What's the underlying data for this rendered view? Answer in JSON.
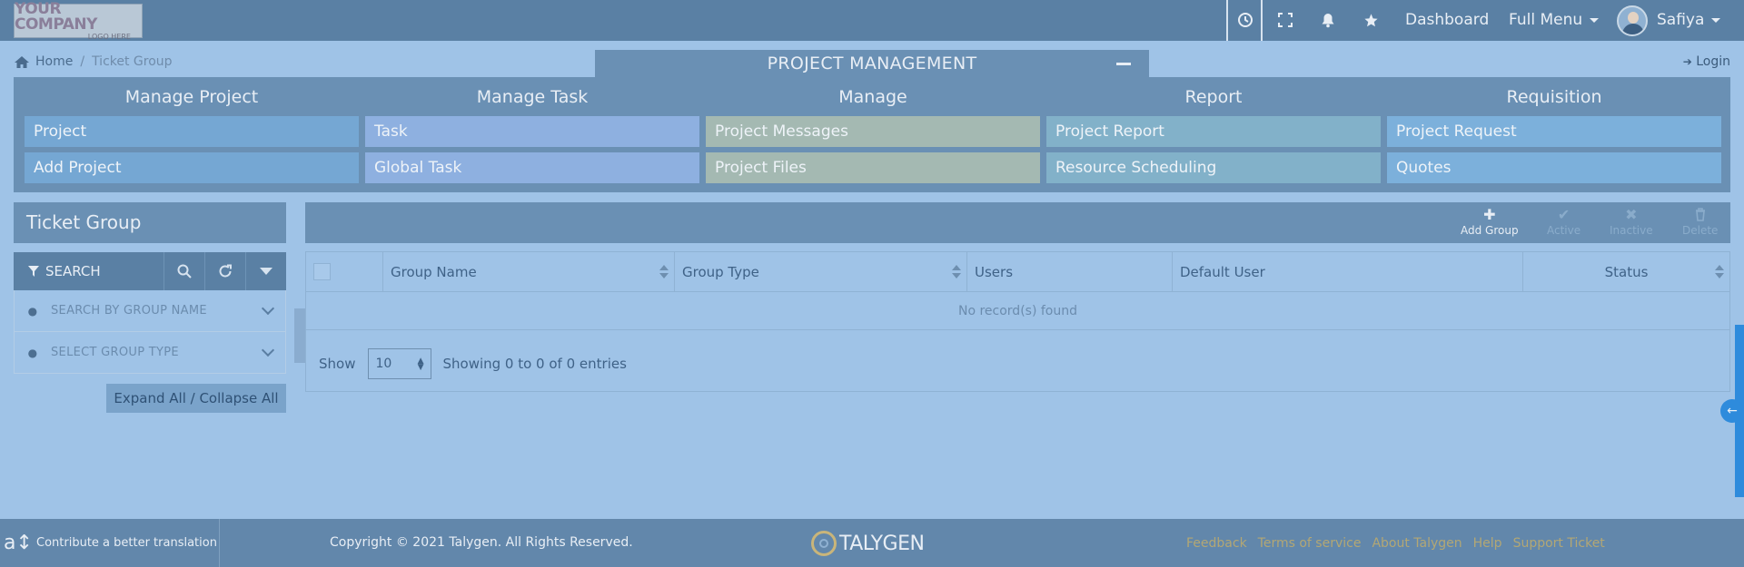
{
  "topbar": {
    "logo_line1": "YOUR COMPANY",
    "logo_line2": "LOGO HERE",
    "dashboard": "Dashboard",
    "full_menu": "Full Menu",
    "user": "Safiya"
  },
  "breadcrumb": {
    "home": "Home",
    "sep": "/",
    "current": "Ticket Group"
  },
  "banner": {
    "title": "PROJECT MANAGEMENT",
    "login": "Login"
  },
  "menu": {
    "columns": [
      {
        "head": "Manage Project",
        "items": [
          "Project",
          "Add Project"
        ]
      },
      {
        "head": "Manage Task",
        "items": [
          "Task",
          "Global Task"
        ]
      },
      {
        "head": "Manage",
        "items": [
          "Project Messages",
          "Project Files"
        ]
      },
      {
        "head": "Report",
        "items": [
          "Project Report",
          "Resource Scheduling"
        ]
      },
      {
        "head": "Requisition",
        "items": [
          "Project Request",
          "Quotes"
        ]
      }
    ]
  },
  "left": {
    "title": "Ticket Group",
    "search_label": "SEARCH",
    "filter1": "SEARCH BY GROUP NAME",
    "filter2": "SELECT GROUP TYPE",
    "expand": "Expand All / Collapse All"
  },
  "toolbar": {
    "add": "Add Group",
    "active": "Active",
    "inactive": "Inactive",
    "delete": "Delete"
  },
  "grid": {
    "columns": [
      "Group Name",
      "Group Type",
      "Users",
      "Default User",
      "Status"
    ],
    "empty": "No record(s) found",
    "show": "Show",
    "page_size": "10",
    "info": "Showing 0 to 0 of 0 entries"
  },
  "footer": {
    "translate": "Contribute a better translation",
    "copyright": "Copyright © 2021 Talygen. All Rights Reserved.",
    "brand": "TALYGEN",
    "links": [
      "Feedback",
      "Terms of service",
      "About Talygen",
      "Help",
      "Support Ticket"
    ]
  },
  "colors": {
    "topbar": "#5a80a4",
    "panel": "#6a90b4",
    "background": "#9fc3e7",
    "accent": "#2e8bdc"
  },
  "icons": [
    "clock-icon",
    "expand-icon",
    "bell-icon",
    "star-icon",
    "home-icon",
    "filter-icon",
    "search-icon",
    "refresh-icon",
    "plus-icon",
    "check-icon",
    "x-icon",
    "trash-icon",
    "pin-icon",
    "translate-icon",
    "login-icon"
  ]
}
